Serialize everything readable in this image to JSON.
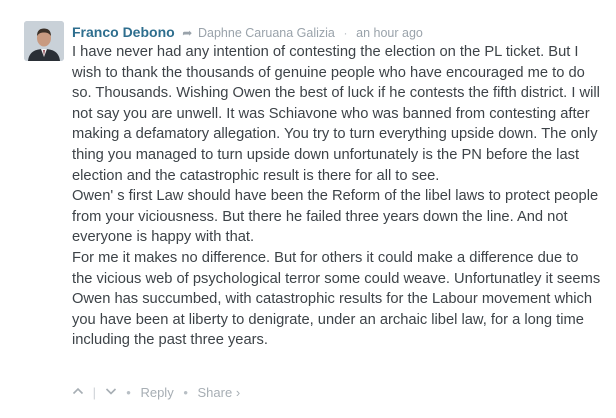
{
  "comment": {
    "author": "Franco Debono",
    "reply_arrow_icon": "reply-arrow-icon",
    "reply_to": "Daphne Caruana Galizia",
    "separator": "·",
    "timestamp": "an hour ago",
    "paragraphs": [
      "I have never had any intention of contesting the election on the PL ticket. But I wish to thank the thousands of genuine people who have encouraged me to do so. Thousands. Wishing Owen the best of luck if he contests the fifth district. I will not say you are unwell. It was Schiavone who was banned from contesting after making a defamatory allegation. You try to turn everything upside down. The only thing you managed to turn upside down unfortunately is the PN before the last election and the catastrophic result is there for all to see.",
      "Owen' s first Law should have been the Reform of the libel laws to protect people from your viciousness. But there he failed three years down the line. And not everyone is happy with that.",
      "For me it makes no difference. But for others it could make a difference due to the vicious web of psychological terror some could weave. Unfortunatley it seems Owen has succumbed, with catastrophic results for the Labour movement which you have been at liberty to denigrate, under an archaic libel law, for a long time including the past three years."
    ],
    "actions": {
      "upvote_icon": "chevron-up-icon",
      "downvote_icon": "chevron-down-icon",
      "divider": "|",
      "dot": "•",
      "reply_label": "Reply",
      "share_label": "Share ›"
    }
  }
}
